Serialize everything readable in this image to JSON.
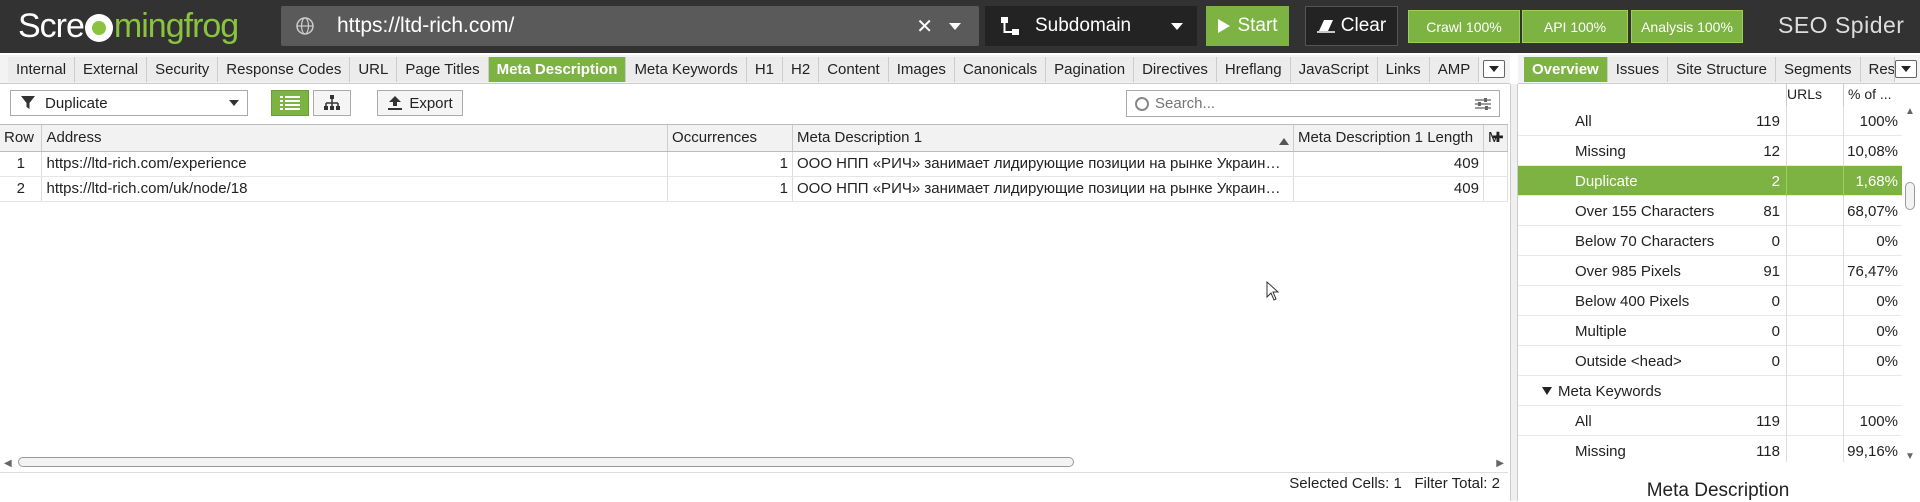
{
  "app": {
    "logo_text_a": "Scre",
    "logo_text_b": "mingfrog",
    "brand": "SEO Spider"
  },
  "toolbar": {
    "url_value": "https://ltd-rich.com/",
    "mode": "Subdomain",
    "start_label": "Start",
    "clear_label": "Clear",
    "crawl_label": "Crawl 100%",
    "api_label": "API 100%",
    "analysis_label": "Analysis 100%"
  },
  "tabs": [
    "Internal",
    "External",
    "Security",
    "Response Codes",
    "URL",
    "Page Titles",
    "Meta Description",
    "Meta Keywords",
    "H1",
    "H2",
    "Content",
    "Images",
    "Canonicals",
    "Pagination",
    "Directives",
    "Hreflang",
    "JavaScript",
    "Links",
    "AMP"
  ],
  "active_tab": "Meta Description",
  "right_tabs": [
    "Overview",
    "Issues",
    "Site Structure",
    "Segments",
    "Res"
  ],
  "filter": {
    "selected": "Duplicate",
    "export_label": "Export",
    "search_placeholder": "Search..."
  },
  "table": {
    "columns": [
      "Row",
      "Address",
      "Occurrences",
      "Meta Description 1",
      "Meta Description 1 Length",
      "M"
    ],
    "rows": [
      {
        "row": "1",
        "address": "https://ltd-rich.com/experience",
        "occurrences": "1",
        "meta": "ООО НПП «РИЧ» занимает лидирующие позиции на рынке Украин…",
        "length": "409"
      },
      {
        "row": "2",
        "address": "https://ltd-rich.com/uk/node/18",
        "occurrences": "1",
        "meta": "ООО НПП «РИЧ» занимает лидирующие позиции на рынке Украин…",
        "length": "409"
      }
    ]
  },
  "status": {
    "selected_cells_label": "Selected Cells:",
    "selected_cells": "1",
    "filter_total_label": "Filter Total:",
    "filter_total": "2"
  },
  "overview": {
    "col_urls": "URLs",
    "col_pct": "% of ...",
    "rows": [
      {
        "label": "All",
        "count": "119",
        "pct": "100%"
      },
      {
        "label": "Missing",
        "count": "12",
        "pct": "10,08%"
      },
      {
        "label": "Duplicate",
        "count": "2",
        "pct": "1,68%"
      },
      {
        "label": "Over 155 Characters",
        "count": "81",
        "pct": "68,07%"
      },
      {
        "label": "Below 70 Characters",
        "count": "0",
        "pct": "0%"
      },
      {
        "label": "Over 985 Pixels",
        "count": "91",
        "pct": "76,47%"
      },
      {
        "label": "Below 400 Pixels",
        "count": "0",
        "pct": "0%"
      },
      {
        "label": "Multiple",
        "count": "0",
        "pct": "0%"
      },
      {
        "label": "Outside <head>",
        "count": "0",
        "pct": "0%"
      },
      {
        "label": "Meta Keywords",
        "count": "",
        "pct": ""
      },
      {
        "label": "All",
        "count": "119",
        "pct": "100%"
      },
      {
        "label": "Missing",
        "count": "118",
        "pct": "99,16%"
      }
    ],
    "section_title": "Meta Description"
  },
  "colors": {
    "accent": "#7cb342",
    "topbar": "#323232"
  }
}
